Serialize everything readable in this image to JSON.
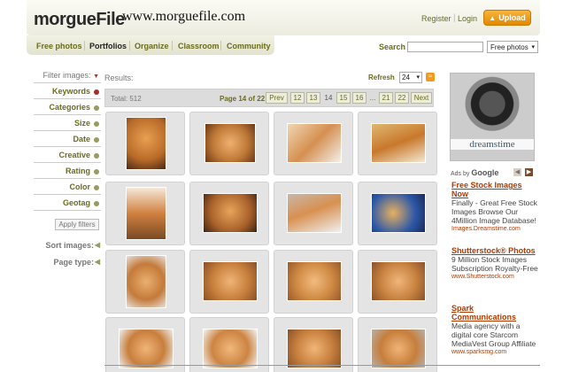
{
  "header": {
    "logo_morgue": "morgue",
    "logo_file": "File",
    "site_url": "www.morguefile.com",
    "register": "Register",
    "separator": "|",
    "login": "Login",
    "upload": "Upload"
  },
  "nav": {
    "items": [
      "Free photos",
      "Portfolios",
      "Organize",
      "Classroom",
      "Community"
    ],
    "active": "Portfolios"
  },
  "search": {
    "label": "Search",
    "input_value": "",
    "select_value": "Free photos"
  },
  "sidebar": {
    "filter_label": "Filter images:",
    "filters": [
      "Keywords",
      "Categories",
      "Size",
      "Date",
      "Creative",
      "Rating",
      "Color",
      "Geotag"
    ],
    "apply_label": "Apply filters",
    "sort_label": "Sort images:",
    "page_type_label": "Page type:"
  },
  "results": {
    "label": "Results:",
    "refresh": "Refresh",
    "per_page": "24",
    "total": "Total: 512",
    "page_of": "Page 14 of 22",
    "pager": [
      "Prev",
      "12",
      "13",
      "14",
      "15",
      "16",
      "...",
      "21",
      "22",
      "Next"
    ],
    "current_page": "14"
  },
  "ads": {
    "banner_brand": "dreamstime",
    "ads_by": "Ads by",
    "google": "Google",
    "items": [
      {
        "title": "Free Stock Images Now",
        "body": "Finally - Great Free Stock Images Browse Our 4Million Image Database!",
        "url": "Images.Dreamstime.com"
      },
      {
        "title": "Shutterstock® Photos",
        "body": "9 Million Stock Images Subscription Royalty-Free",
        "url": "www.Shutterstock.com"
      },
      {
        "title": "Spark Communications",
        "body": "Media agency with a digital core Starcom MediaVest Group Affiliate",
        "url": "www.sparksmg.com"
      }
    ]
  },
  "colors": {
    "accent": "#6b6b1e",
    "upload": "#f0a020",
    "ad_link": "#b03a00"
  }
}
